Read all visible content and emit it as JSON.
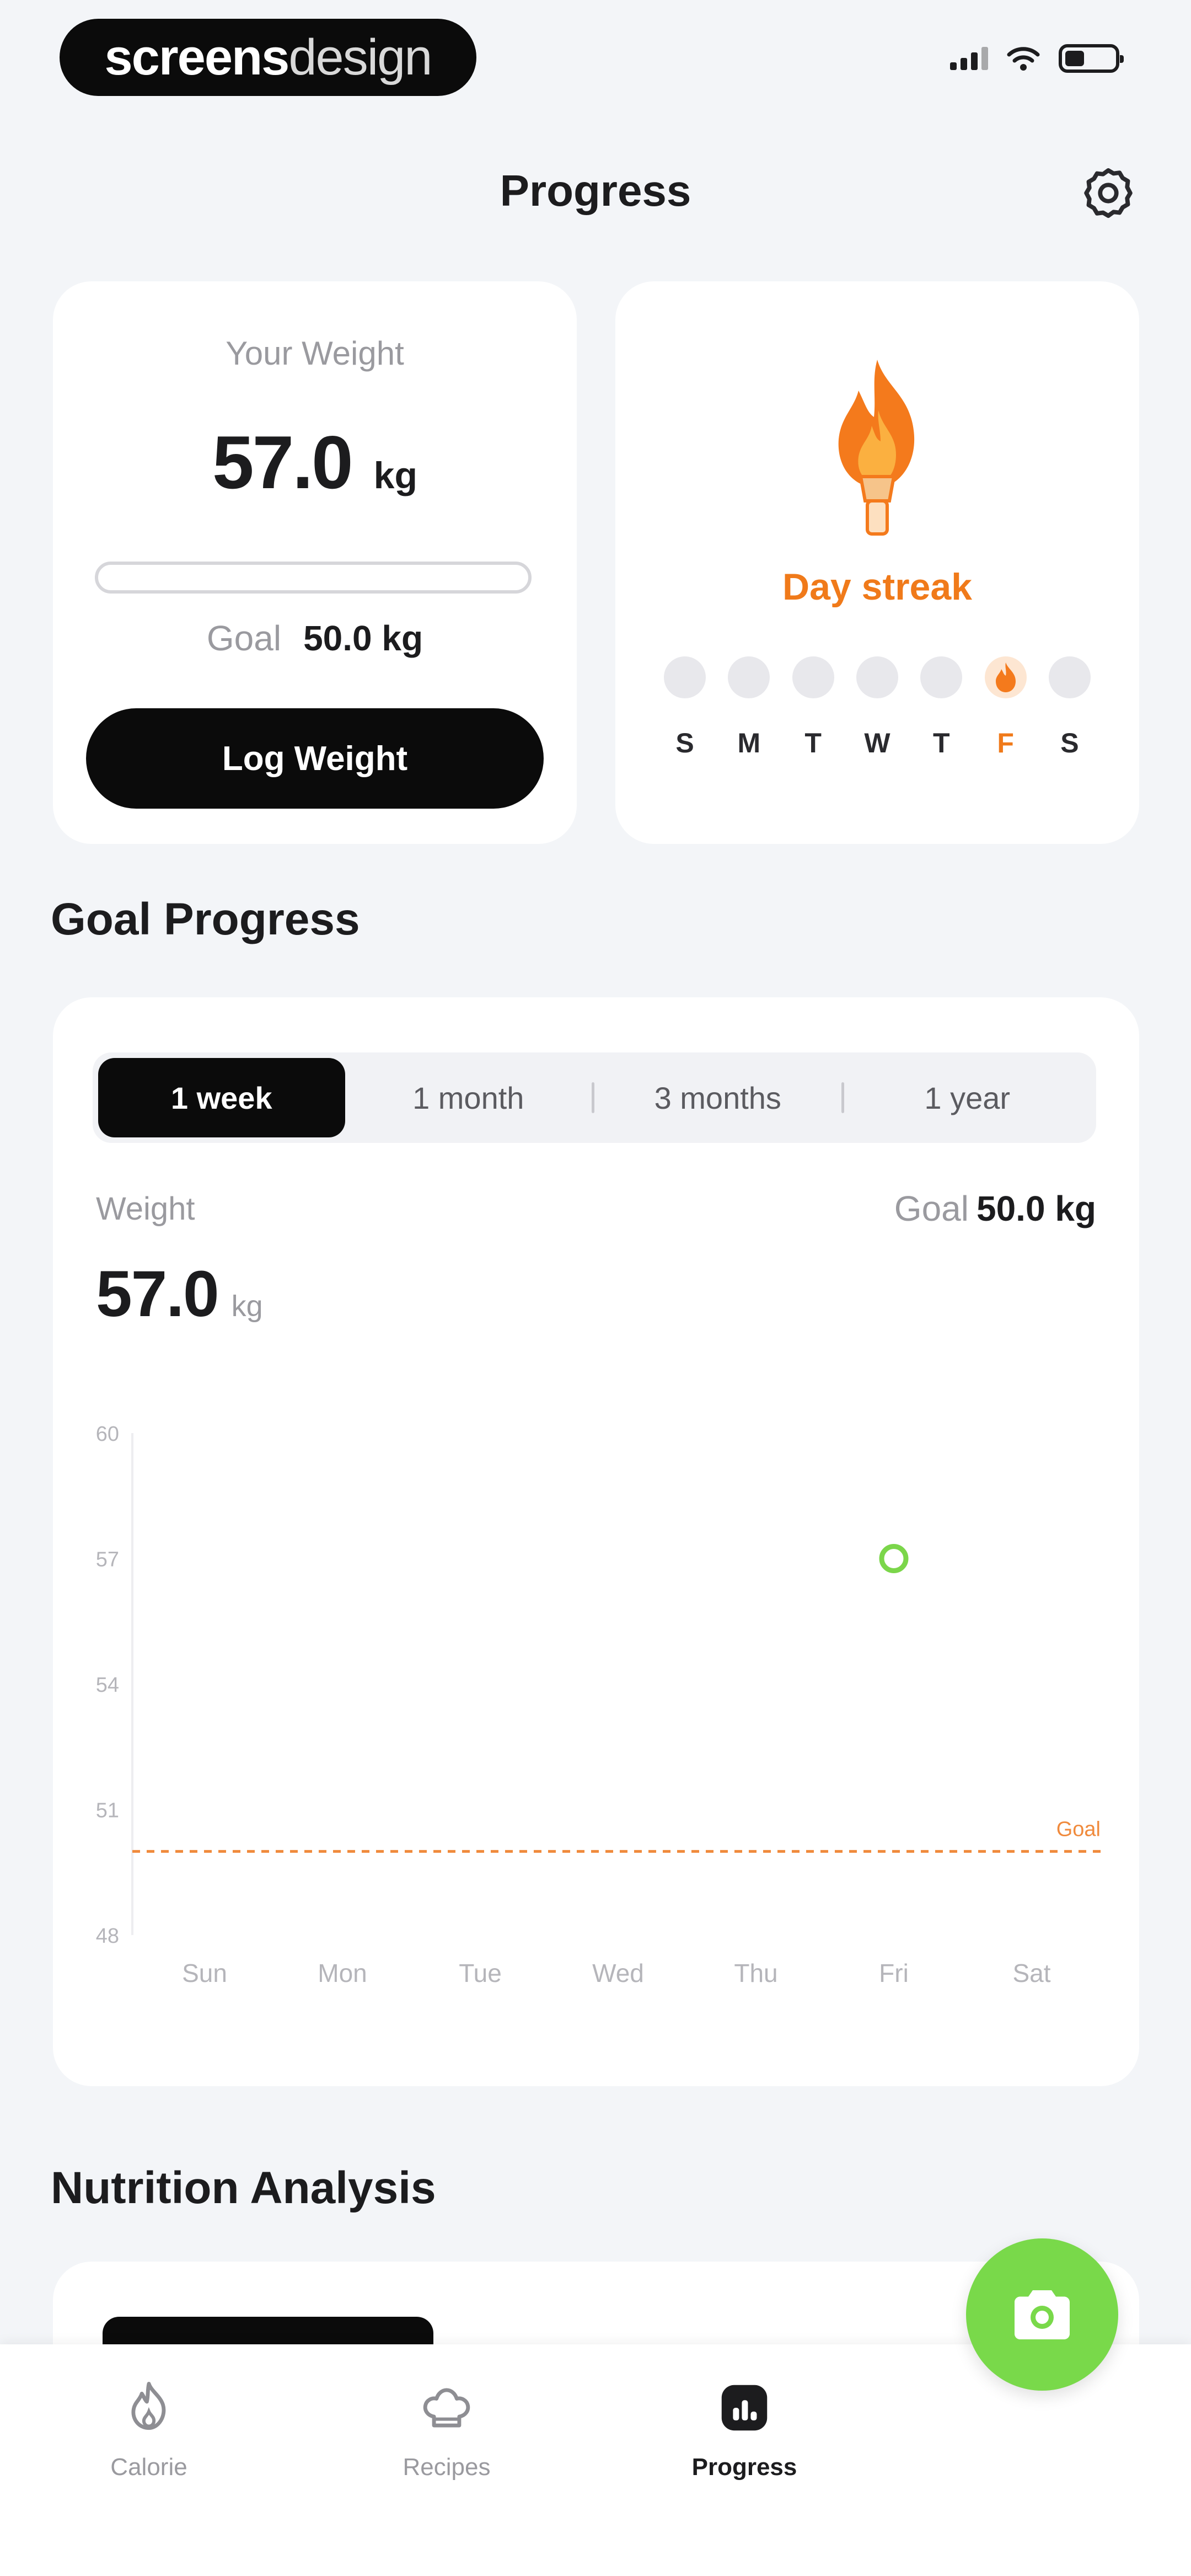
{
  "status_bar": {
    "brand_part1": "screens",
    "brand_part2": "design"
  },
  "header": {
    "title": "Progress",
    "settings_icon": "gear-icon"
  },
  "weight_card": {
    "label": "Your Weight",
    "value": "57.0",
    "unit": "kg",
    "goal_label": "Goal",
    "goal_value": "50.0 kg",
    "progress": 0,
    "button_label": "Log Weight"
  },
  "streak_card": {
    "icon": "flame-torch-icon",
    "title": "Day streak",
    "days": [
      {
        "letter": "S",
        "active": false
      },
      {
        "letter": "M",
        "active": false
      },
      {
        "letter": "T",
        "active": false
      },
      {
        "letter": "W",
        "active": false
      },
      {
        "letter": "T",
        "active": false
      },
      {
        "letter": "F",
        "active": true
      },
      {
        "letter": "S",
        "active": false
      }
    ],
    "accent_color": "#f07a1a"
  },
  "goal_progress": {
    "section_title": "Goal Progress",
    "tabs": [
      {
        "label": "1 week",
        "active": true
      },
      {
        "label": "1 month",
        "active": false
      },
      {
        "label": "3 months",
        "active": false
      },
      {
        "label": "1 year",
        "active": false
      }
    ],
    "weight_label": "Weight",
    "weight_value": "57.0",
    "weight_unit": "kg",
    "goal_label": "Goal",
    "goal_value": "50.0 kg"
  },
  "chart_data": {
    "type": "scatter",
    "categories": [
      "Sun",
      "Mon",
      "Tue",
      "Wed",
      "Thu",
      "Fri",
      "Sat"
    ],
    "series": [
      {
        "values": [
          null,
          null,
          null,
          null,
          null,
          57.0,
          null
        ]
      }
    ],
    "yticks": [
      48,
      51,
      54,
      57,
      60
    ],
    "ylim": [
      48,
      60
    ],
    "goal_line": {
      "value": 50.0,
      "label": "Goal",
      "color": "#f08a3c"
    },
    "point_color": "#7bd64a",
    "grid": false
  },
  "nutrition": {
    "section_title": "Nutrition Analysis"
  },
  "bottom_nav": {
    "items": [
      {
        "label": "Calorie",
        "icon": "calorie-flame-icon",
        "active": false
      },
      {
        "label": "Recipes",
        "icon": "chef-hat-icon",
        "active": false
      },
      {
        "label": "Progress",
        "icon": "progress-chart-icon",
        "active": true
      }
    ],
    "fab_icon": "camera-icon",
    "fab_color": "#79d94a"
  }
}
